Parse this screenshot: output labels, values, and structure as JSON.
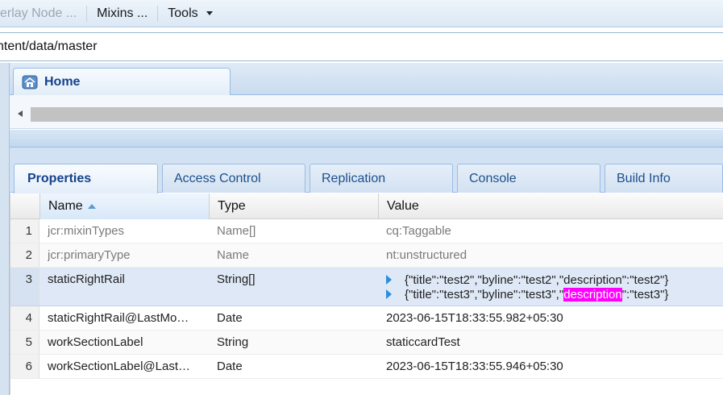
{
  "toolbar": {
    "items": [
      {
        "label": "erlay Node ...",
        "disabled": true
      },
      {
        "label": "Mixins ..."
      },
      {
        "label": "Tools"
      }
    ]
  },
  "path": {
    "value": "ntent/data/master"
  },
  "tabs": {
    "home_label": "Home"
  },
  "inner_tabs": [
    {
      "label": "Properties",
      "active": true
    },
    {
      "label": "Access Control"
    },
    {
      "label": "Replication"
    },
    {
      "label": "Console"
    },
    {
      "label": "Build Info"
    }
  ],
  "grid": {
    "columns": {
      "name": "Name",
      "type": "Type",
      "value": "Value"
    },
    "rows": [
      {
        "num": "1",
        "name": "jcr:mixinTypes",
        "type": "Name[]",
        "value": "cq:Taggable"
      },
      {
        "num": "2",
        "name": "jcr:primaryType",
        "type": "Name",
        "value": "nt:unstructured"
      },
      {
        "num": "3",
        "name": "staticRightRail",
        "type": "String[]",
        "values": [
          {
            "text": "{\"title\":\"test2\",\"byline\":\"test2\",\"description\":\"test2\"}"
          },
          {
            "pre": "{\"title\":\"test3\",\"byline\":\"test3\",\"",
            "highlight": "description",
            "post": "\":\"test3\"}"
          }
        ]
      },
      {
        "num": "4",
        "name": "staticRightRail@LastMo…",
        "type": "Date",
        "value": "2023-06-15T18:33:55.982+05:30"
      },
      {
        "num": "5",
        "name": "workSectionLabel",
        "type": "String",
        "value": "staticcardTest"
      },
      {
        "num": "6",
        "name": "workSectionLabel@Last…",
        "type": "Date",
        "value": "2023-06-15T18:33:55.946+05:30"
      }
    ]
  },
  "colors": {
    "highlight": "#ff00ff",
    "accent": "#15428b",
    "expand_arrow": "#2a8fdc"
  }
}
